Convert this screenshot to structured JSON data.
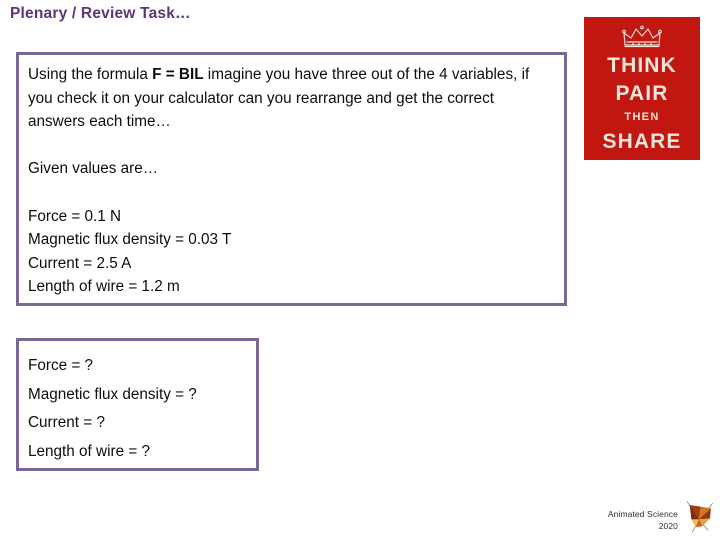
{
  "slide": {
    "title": "Plenary / Review Task…"
  },
  "given_box": {
    "paragraph_prefix": "Using the formula ",
    "paragraph_bold": "F = BIL",
    "paragraph_suffix": " imagine you have three out of the 4 variables, if you check it on your calculator can you rearrange and get the correct answers each time…",
    "given_heading": "Given values are…",
    "values": [
      "Force = 0.1 N",
      "Magnetic flux density = 0.03 T",
      "Current = 2.5 A",
      "Length of wire = 1.2 m"
    ]
  },
  "unknown_box": {
    "values": [
      "Force = ?",
      "Magnetic flux density = ?",
      "Current = ?",
      "Length of wire = ?"
    ]
  },
  "poster": {
    "line1": "THINK",
    "line2": "PAIR",
    "line3": "THEN",
    "line4": "SHARE",
    "background_color": "#c11710",
    "text_color": "#f0e6dc"
  },
  "footer": {
    "credit": "Animated Science",
    "year": "2020"
  },
  "colors": {
    "title_purple": "#5e3378",
    "box_border_purple": "#7b6795",
    "poster_red": "#c11710"
  }
}
